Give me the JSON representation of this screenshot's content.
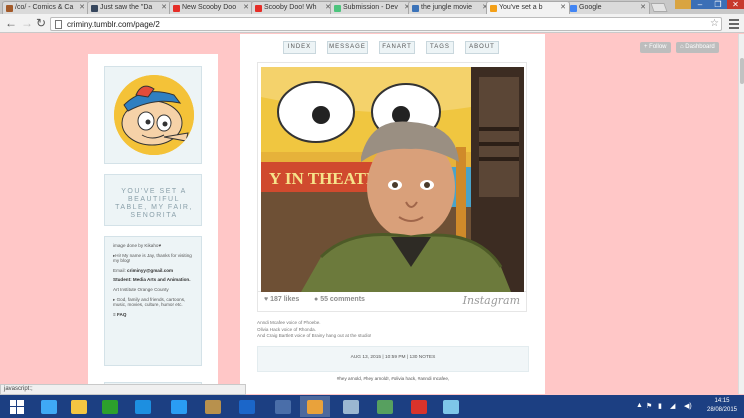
{
  "browser": {
    "tabs": [
      {
        "label": "/co/ - Comics & Ca",
        "favicon_color": "#a35a2a",
        "active": false
      },
      {
        "label": "Just saw the \"Da",
        "favicon_color": "#36465d",
        "active": false
      },
      {
        "label": "New Scooby Doo",
        "favicon_color": "#e52d27",
        "active": false
      },
      {
        "label": "Scooby Doo! Wh",
        "favicon_color": "#e52d27",
        "active": false
      },
      {
        "label": "Submission - Dev",
        "favicon_color": "#4dc47d",
        "active": false
      },
      {
        "label": "the jungle movie",
        "favicon_color": "#3b73b9",
        "active": false
      },
      {
        "label": "You've set a b",
        "favicon_color": "#f4a018",
        "active": true
      },
      {
        "label": "Google",
        "favicon_color": "#4285f4",
        "active": false
      }
    ],
    "url": "criminy.tumblr.com/page/2",
    "status_text": "javascript:;"
  },
  "blog": {
    "nav": [
      "INDEX",
      "MESSAGE",
      "FANART",
      "TAGS",
      "ABOUT"
    ],
    "follow_label": "+ Follow",
    "dashboard_label": "Dashboard",
    "title": "YOU'VE SET A BEAUTIFUL TABLE, MY FAIR, SENORITA",
    "bio": {
      "credit": "image done by Kikaho♥",
      "intro": "▸Hi! My name is Jay, thanks for visiting my blog!",
      "email_label": "Email:",
      "email": "criminyy@gmail.com",
      "student": "Student: Media Arts and Animation.",
      "school": "Art Institute Orange County",
      "likes": "▸ God, family and friends, cartoons, music, movies, culture, humor etc.",
      "faq": "≡ FAQ"
    },
    "post": {
      "likes": "187 likes",
      "comments": "55 comments",
      "instagram": "Instagram",
      "caption": [
        "Anndi Mcafee voice of Phoebe.",
        "Olivia Hack voice of Rhonda.",
        "And Craig Bartlett voice of Brainy hang out at the studio!"
      ],
      "photo_sign": "Y IN THEATR",
      "date": "AUG 13, 2015",
      "time": "10:59 PM",
      "notes": "130 NOTES",
      "tags": "#hey arnold, #hey arnold!, #olivia hack, #anndi mcafee,"
    },
    "nb_badge": "NB"
  },
  "taskbar": {
    "apps": [
      {
        "name": "internet-explorer",
        "color": "#3fa9f5",
        "active": false
      },
      {
        "name": "file-explorer",
        "color": "#f4c542",
        "active": false
      },
      {
        "name": "store",
        "color": "#2ca02c",
        "active": false
      },
      {
        "name": "mail",
        "color": "#1d8fe0",
        "active": false
      },
      {
        "name": "remote-desktop",
        "color": "#2a9df4",
        "active": false
      },
      {
        "name": "media-app",
        "color": "#b8914d",
        "active": false
      },
      {
        "name": "maxthon",
        "color": "#1b66c9",
        "active": false
      },
      {
        "name": "bird-app",
        "color": "#4a6ea9",
        "active": false
      },
      {
        "name": "chrome",
        "color": "#e9a23b",
        "active": true
      },
      {
        "name": "paint",
        "color": "#9bb7d1",
        "active": false
      },
      {
        "name": "photo-app",
        "color": "#57a05f",
        "active": false
      },
      {
        "name": "mail-app",
        "color": "#d9332b",
        "active": false
      },
      {
        "name": "recycle-bin",
        "color": "#7ec6e8",
        "active": false
      }
    ],
    "time": "14:15",
    "date": "28/08/2015"
  }
}
